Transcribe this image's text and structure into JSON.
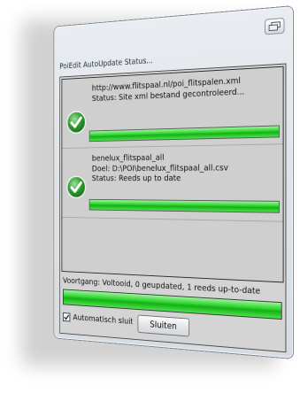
{
  "window": {
    "title": "PoiEdit AutoUpdate Status..."
  },
  "items": [
    {
      "line1": "http://www.flitspaal.nl/poi_flitspalen.xml",
      "line2": "Status: Site xml bestand gecontroleerd...",
      "line3": "",
      "status_icon": "green-check-icon",
      "progress": 1.0
    },
    {
      "line1": "benelux_flitspaal_all",
      "line2": "Doel: D:\\POI\\benelux_flitspaal_all.csv",
      "line3": "Status: Reeds up to date",
      "status_icon": "green-check-icon",
      "progress": 1.0
    }
  ],
  "footer": {
    "status_text": "Voortgang: Voltooid, 0 geupdated, 1 reeds up-to-date",
    "overall_progress": 1.0,
    "auto_close_label": "Automatisch sluiten",
    "auto_close_checked": true,
    "close_button_label": "Sluiten"
  },
  "colors": {
    "progress_green": "#22cc22",
    "check_green": "#2e9a2e"
  }
}
